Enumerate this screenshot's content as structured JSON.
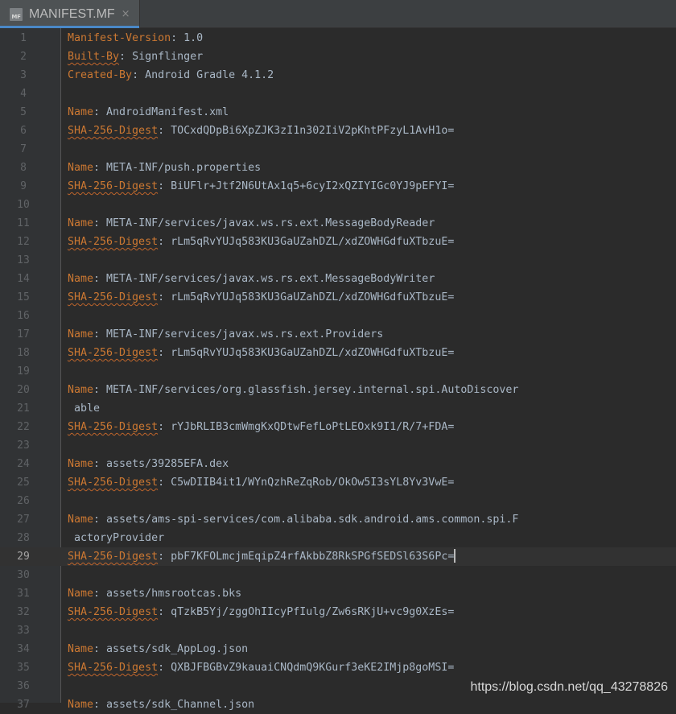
{
  "tab": {
    "title": "MANIFEST.MF",
    "icon": "manifest-file-icon",
    "icon_text": "MF",
    "close": "×"
  },
  "lines": [
    {
      "n": "1",
      "key": "Manifest-Version",
      "warn": false,
      "value": "1.0"
    },
    {
      "n": "2",
      "key": "Built-By",
      "warn": true,
      "value": "Signflinger"
    },
    {
      "n": "3",
      "key": "Created-By",
      "warn": false,
      "value": "Android Gradle 4.1.2"
    },
    {
      "n": "4"
    },
    {
      "n": "5",
      "key": "Name",
      "warn": false,
      "value": "AndroidManifest.xml"
    },
    {
      "n": "6",
      "key": "SHA-256-Digest",
      "warn": true,
      "value": "TOCxdQDpBi6XpZJK3zI1n302IiV2pKhtPFzyL1AvH1o="
    },
    {
      "n": "7"
    },
    {
      "n": "8",
      "key": "Name",
      "warn": false,
      "value": "META-INF/push.properties"
    },
    {
      "n": "9",
      "key": "SHA-256-Digest",
      "warn": true,
      "value": "BiUFlr+Jtf2N6UtAx1q5+6cyI2xQZIYIGc0YJ9pEFYI="
    },
    {
      "n": "10"
    },
    {
      "n": "11",
      "key": "Name",
      "warn": false,
      "value": "META-INF/services/javax.ws.rs.ext.MessageBodyReader"
    },
    {
      "n": "12",
      "key": "SHA-256-Digest",
      "warn": true,
      "value": "rLm5qRvYUJq583KU3GaUZahDZL/xdZOWHGdfuXTbzuE="
    },
    {
      "n": "13"
    },
    {
      "n": "14",
      "key": "Name",
      "warn": false,
      "value": "META-INF/services/javax.ws.rs.ext.MessageBodyWriter"
    },
    {
      "n": "15",
      "key": "SHA-256-Digest",
      "warn": true,
      "value": "rLm5qRvYUJq583KU3GaUZahDZL/xdZOWHGdfuXTbzuE="
    },
    {
      "n": "16"
    },
    {
      "n": "17",
      "key": "Name",
      "warn": false,
      "value": "META-INF/services/javax.ws.rs.ext.Providers"
    },
    {
      "n": "18",
      "key": "SHA-256-Digest",
      "warn": true,
      "value": "rLm5qRvYUJq583KU3GaUZahDZL/xdZOWHGdfuXTbzuE="
    },
    {
      "n": "19"
    },
    {
      "n": "20",
      "key": "Name",
      "warn": false,
      "value": "META-INF/services/org.glassfish.jersey.internal.spi.AutoDiscover"
    },
    {
      "n": "21",
      "cont": "able"
    },
    {
      "n": "22",
      "key": "SHA-256-Digest",
      "warn": true,
      "value": "rYJbRLIB3cmWmgKxQDtwFefLoPtLEOxk9I1/R/7+FDA="
    },
    {
      "n": "23"
    },
    {
      "n": "24",
      "key": "Name",
      "warn": false,
      "value": "assets/39285EFA.dex"
    },
    {
      "n": "25",
      "key": "SHA-256-Digest",
      "warn": true,
      "value": "C5wDIIB4it1/WYnQzhReZqRob/OkOw5I3sYL8Yv3VwE="
    },
    {
      "n": "26"
    },
    {
      "n": "27",
      "key": "Name",
      "warn": false,
      "value": "assets/ams-spi-services/com.alibaba.sdk.android.ams.common.spi.F"
    },
    {
      "n": "28",
      "cont": "actoryProvider"
    },
    {
      "n": "29",
      "key": "SHA-256-Digest",
      "warn": true,
      "value": "pbF7KFOLmcjmEqipZ4rfAkbbZ8RkSPGfSEDSl63S6Pc=",
      "current": true
    },
    {
      "n": "30"
    },
    {
      "n": "31",
      "key": "Name",
      "warn": false,
      "value": "assets/hmsrootcas.bks"
    },
    {
      "n": "32",
      "key": "SHA-256-Digest",
      "warn": true,
      "value": "qTzkB5Yj/zggOhIIcyPfIulg/Zw6sRKjU+vc9g0XzEs="
    },
    {
      "n": "33"
    },
    {
      "n": "34",
      "key": "Name",
      "warn": false,
      "value": "assets/sdk_AppLog.json"
    },
    {
      "n": "35",
      "key": "SHA-256-Digest",
      "warn": true,
      "value": "QXBJFBGBvZ9kauaiCNQdmQ9KGurf3eKE2IMjp8goMSI="
    },
    {
      "n": "36"
    },
    {
      "n": "37",
      "key": "Name",
      "warn": false,
      "value": "assets/sdk_Channel.json"
    }
  ],
  "separator": ": ",
  "watermark": "https://blog.csdn.net/qq_43278826",
  "colors": {
    "background": "#2b2b2b",
    "key": "#cc7832",
    "value": "#a9b7c6",
    "line_number": "#606366",
    "warning_underline": "#c0652b"
  }
}
